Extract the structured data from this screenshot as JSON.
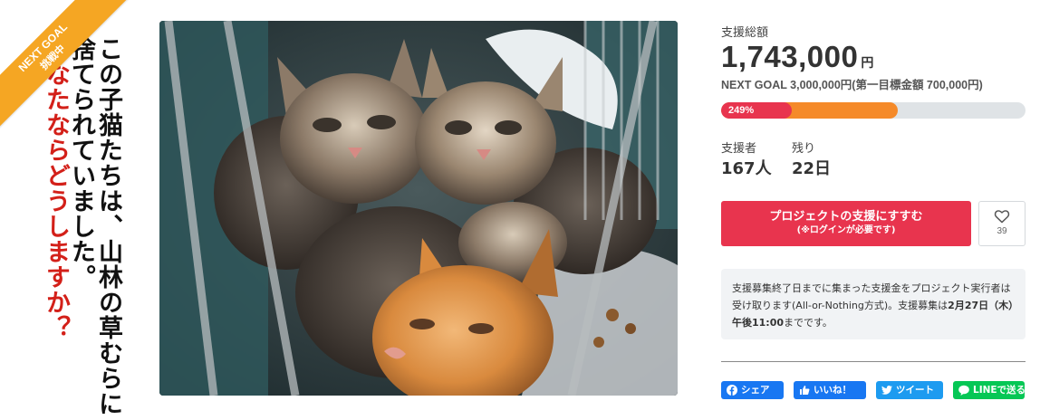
{
  "left_panel": {
    "ribbon": {
      "line1": "NEXT GOAL",
      "line2": "挑戦中"
    },
    "vertical_text": {
      "col1": "この子猫たちは、山林の草むらに",
      "col2": "捨てられていました。",
      "col3": "あなたならどうしますか？"
    }
  },
  "main_image": {
    "alt": "kittens photo"
  },
  "funding": {
    "total_label": "支援総額",
    "amount": "1,743,000",
    "unit": "円",
    "next_goal": "NEXT GOAL 3,000,000円(第一目標金額 700,000円)",
    "progress_label": "249%",
    "progress_fraction_of_next_goal": 0.581,
    "first_goal_fraction_of_bar": 0.233
  },
  "stats": {
    "backers_label": "支援者",
    "backers_value": "167人",
    "remaining_label": "残り",
    "remaining_value": "22日"
  },
  "actions": {
    "support_button": "プロジェクトの支援にすすむ",
    "support_button_sub": "(※ログインが必要です)",
    "favorite_icon": "heart-icon",
    "favorite_count": "39"
  },
  "notice": {
    "part1": "支援募集終了日までに集まった支援金をプロジェクト実行者は受け取ります(All-or-Nothing方式)。支援募集は",
    "bold_date": "2月27日（木）午後11:00",
    "part2": "までです。"
  },
  "share": {
    "facebook": "シェア",
    "like": "いいね！",
    "twitter": "ツイート",
    "line": "LINEで送る"
  },
  "colors": {
    "accent_red": "#e8344e",
    "progress_orange": "#f58a29",
    "ribbon_orange": "#f5a623",
    "facebook_blue": "#1877f2",
    "twitter_blue": "#1d9bf0",
    "line_green": "#06c755"
  }
}
